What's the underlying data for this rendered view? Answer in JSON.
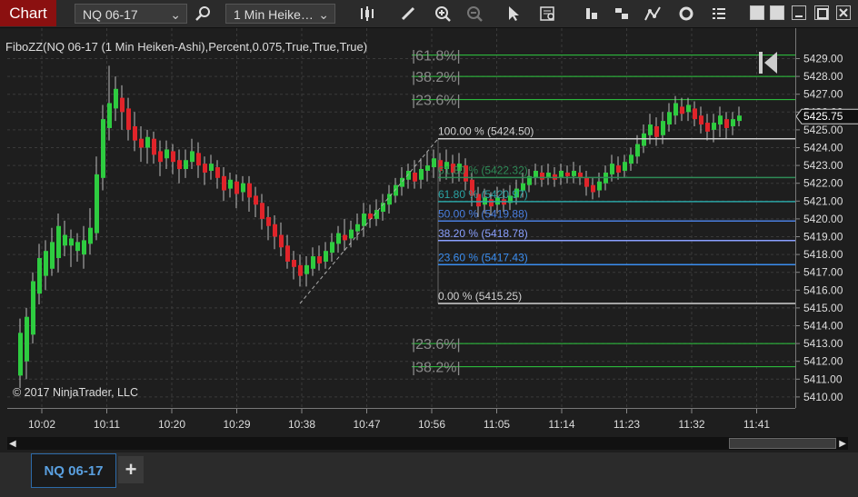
{
  "toolbar": {
    "chart_label": "Chart",
    "instrument": "NQ 06-17",
    "interval": "1 Min Heike…"
  },
  "indicator_label": "FiboZZ(NQ 06-17 (1 Min Heiken-Ashi),Percent,0.075,True,True,True)",
  "copyright": "© 2017 NinjaTrader, LLC",
  "tabs": [
    {
      "label": "NQ 06-17"
    }
  ],
  "add_tab_label": "+",
  "colors": {
    "up": "#2ecc40",
    "down": "#e0242a",
    "accent": "#8b1010"
  },
  "price_axis": {
    "labels": [
      "5429.00",
      "5428.00",
      "5427.00",
      "5426.00",
      "5425.00",
      "5424.00",
      "5423.00",
      "5422.00",
      "5421.00",
      "5420.00",
      "5419.00",
      "5418.00",
      "5417.00",
      "5416.00",
      "5415.00",
      "5414.00",
      "5413.00",
      "5412.00",
      "5411.00",
      "5410.00"
    ],
    "current_price": "5425.75"
  },
  "time_axis": {
    "labels": [
      "10:02",
      "10:11",
      "10:20",
      "10:29",
      "10:38",
      "10:47",
      "10:56",
      "11:05",
      "11:14",
      "11:23",
      "11:32",
      "11:41"
    ]
  },
  "fib_levels": [
    {
      "label": "100.00 % (5424.50)",
      "price": 5424.5
    },
    {
      "label": "61.80 % (5422.32)",
      "price": 5422.32
    },
    {
      "label": "61.80 % (5420.97)",
      "price": 5420.97
    },
    {
      "label": "50.00 % (5419.88)",
      "price": 5419.88
    },
    {
      "label": "38.20 % (5418.78)",
      "price": 5418.78
    },
    {
      "label": "23.60 % (5417.43)",
      "price": 5417.43
    },
    {
      "label": "0.00 % (5415.25)",
      "price": 5415.25
    }
  ],
  "ext_levels": [
    {
      "label": "|61.8%|",
      "price": 5429.2
    },
    {
      "label": "|38.2%|",
      "price": 5428.0
    },
    {
      "label": "|23.6%|",
      "price": 5426.7
    },
    {
      "label": "|23.6%|",
      "price": 5413.0
    },
    {
      "label": "|38.2%|",
      "price": 5411.7
    }
  ]
}
